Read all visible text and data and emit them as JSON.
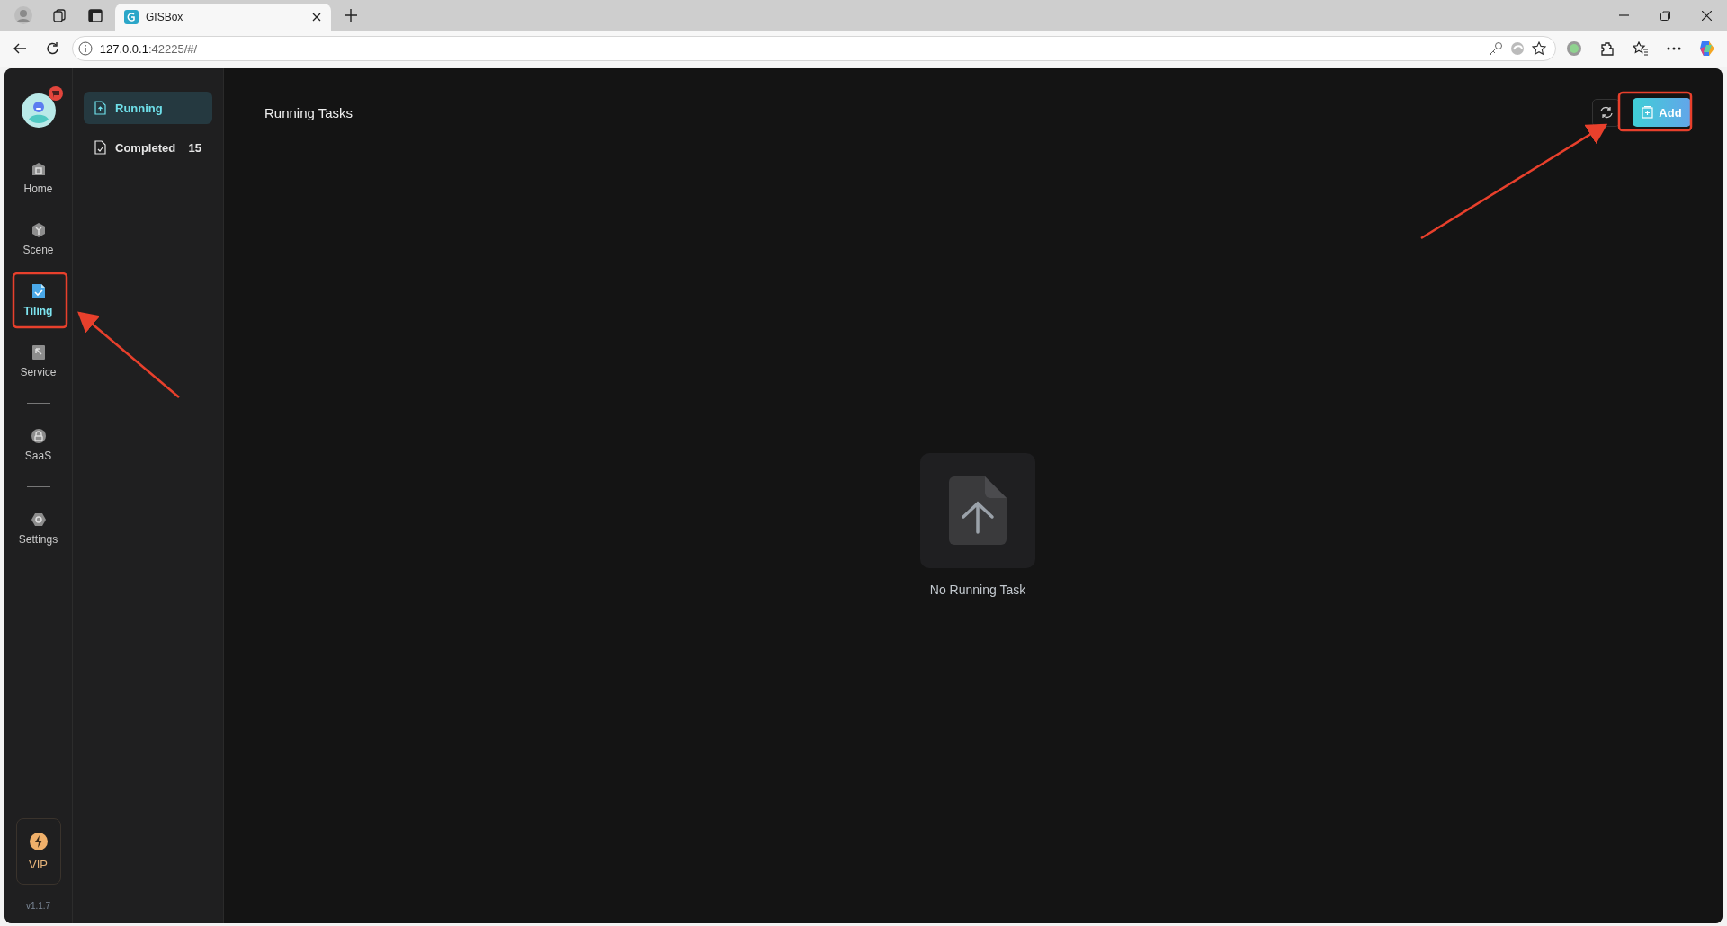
{
  "browser": {
    "tab": {
      "title": "GISBox"
    },
    "address": {
      "host": "127.0.0.1",
      "path": ":42225/#/"
    }
  },
  "rail": {
    "items": [
      {
        "kind": "nav",
        "label": "Home",
        "selected": false
      },
      {
        "kind": "nav",
        "label": "Scene",
        "selected": false
      },
      {
        "kind": "nav",
        "label": "Tiling",
        "selected": true
      },
      {
        "kind": "nav",
        "label": "Service",
        "selected": false
      },
      {
        "kind": "divider"
      },
      {
        "kind": "nav",
        "label": "SaaS",
        "selected": false
      },
      {
        "kind": "divider"
      },
      {
        "kind": "nav",
        "label": "Settings",
        "selected": false
      }
    ],
    "vip": {
      "label": "VIP"
    },
    "version": "v1.1.7"
  },
  "sidebar": {
    "items": [
      {
        "label": "Running",
        "selected": true
      },
      {
        "label": "Completed",
        "count": "15",
        "selected": false
      }
    ]
  },
  "main": {
    "title": "Running Tasks",
    "add_button": "Add",
    "empty_text": "No Running Task"
  }
}
